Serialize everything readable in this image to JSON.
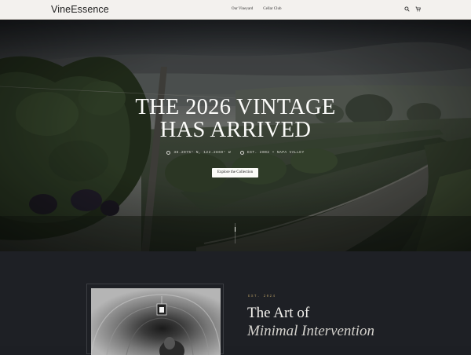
{
  "header": {
    "brand": "VineEssence",
    "nav": [
      "Our Vineyard",
      "Cellar Club"
    ],
    "icons": [
      "search-icon",
      "cart-icon"
    ]
  },
  "hero": {
    "title_line1": "THE 2026 VINTAGE",
    "title_line2": "HAS ARRIVED",
    "coords": "38.2975° N, 122.2869° W",
    "established": "EST. 2002 • NAPA VALLEY",
    "cta_label": "Explore the Collection"
  },
  "story": {
    "eyebrow": "EST. 2024",
    "title_line1": "The Art of",
    "title_line2": "Minimal Intervention"
  },
  "colors": {
    "header_bg": "#f3f1ee",
    "page_dark": "#1e2025",
    "accent_gold": "#a9925f",
    "button_bg": "#fbfbf8"
  }
}
